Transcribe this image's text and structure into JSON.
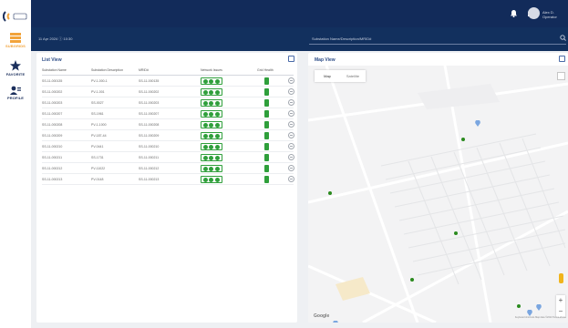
{
  "brand": {
    "logo_text": "SMART GRID"
  },
  "sidebar": {
    "items": [
      {
        "label": "SUBGRIDS",
        "icon": "grid-stack-icon",
        "color": "#f2a33a"
      },
      {
        "label": "FAVORITE",
        "icon": "star-icon",
        "color": "#1b2f5c"
      },
      {
        "label": "PROFILE",
        "icon": "profile-icon",
        "color": "#1b2f5c"
      }
    ]
  },
  "header": {
    "notifications_icon": "bell-icon",
    "messages_icon": "mail-icon",
    "user_name_line1": "Alex D.",
    "user_name_line2": "Operator",
    "datetime": "11 Apr 2024  ⓘ 10:30"
  },
  "search": {
    "placeholder": "Substation Name/Description/MRID#"
  },
  "list_view": {
    "title": "List View",
    "columns": [
      "Substation Name",
      "Substation Description",
      "MRID#",
      "Network Issues",
      "Grid Health",
      ""
    ],
    "rows": [
      {
        "name": "SS-11-000135",
        "desc": "PV-1-000-1",
        "mrid": "SS-11-000135"
      },
      {
        "name": "SS-11-000202",
        "desc": "PV-1-001",
        "mrid": "SS-11-000202"
      },
      {
        "name": "SS-11-000203",
        "desc": "SS-0027",
        "mrid": "SS-11-000203"
      },
      {
        "name": "SS-11-000207",
        "desc": "SS-1961",
        "mrid": "SS-11-000207"
      },
      {
        "name": "SS-11-000208",
        "desc": "PV-1-1000",
        "mrid": "SS-11-000208"
      },
      {
        "name": "SS-11-000209",
        "desc": "PV-187-44",
        "mrid": "SS-11-000209"
      },
      {
        "name": "SS-11-000210",
        "desc": "PV-0441",
        "mrid": "SS-11-000210"
      },
      {
        "name": "SS-11-000211",
        "desc": "SS-1731",
        "mrid": "SS-11-000211"
      },
      {
        "name": "SS-11-000212",
        "desc": "PV-11022",
        "mrid": "SS-11-000212"
      },
      {
        "name": "SS-11-000213",
        "desc": "PV-0148",
        "mrid": "SS-11-000213"
      }
    ]
  },
  "map_view": {
    "title": "Map View",
    "map_label": "Map",
    "satellite_label": "Satellite",
    "zoom_in": "+",
    "zoom_out": "−",
    "google_label": "Google",
    "attribution": "Keyboard shortcuts  Map data ©2024  Terms of Use"
  },
  "colors": {
    "navy": "#122b5a",
    "status_green": "#2f9f3b",
    "accent_orange": "#f2a33a"
  }
}
